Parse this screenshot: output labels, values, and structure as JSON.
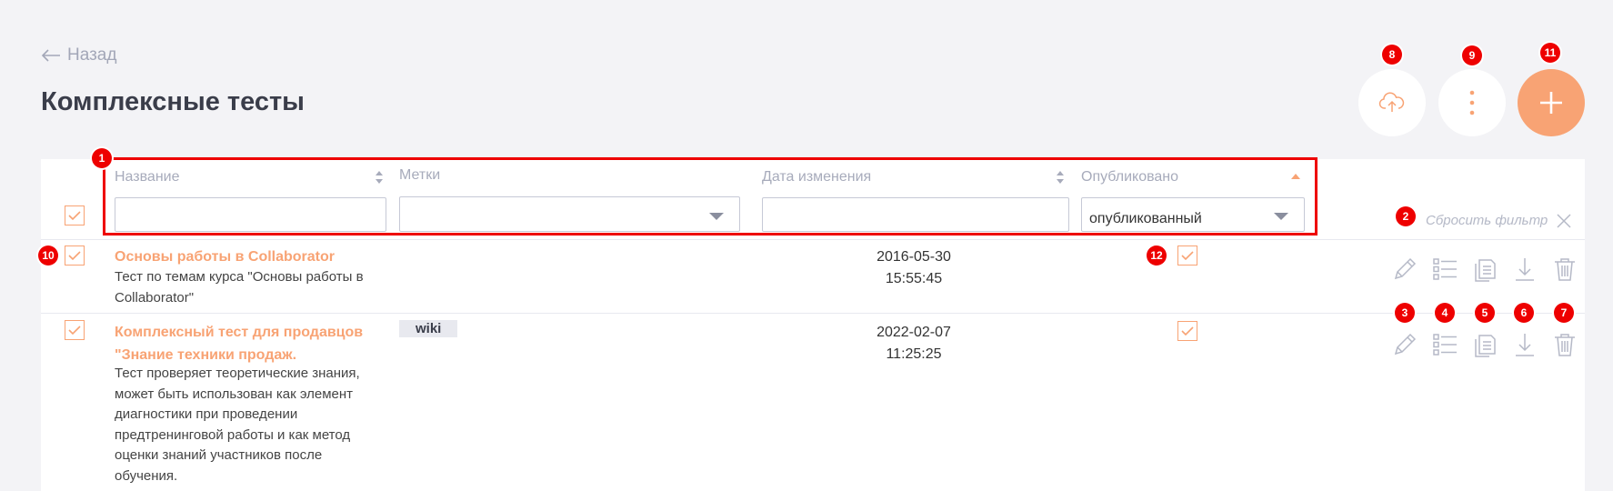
{
  "header": {
    "back_label": "Назад",
    "title": "Комплексные тесты"
  },
  "toolbar": {
    "upload_icon": "cloud-upload-icon",
    "more_icon": "more-vertical-icon",
    "add_icon": "plus-icon"
  },
  "filters": {
    "columns": {
      "name": "Название",
      "tags": "Метки",
      "date": "Дата изменения",
      "published": "Опубликовано"
    },
    "name_value": "",
    "tags_value": "",
    "date_value": "",
    "published_value": "опубликованный",
    "reset_label": "Сбросить фильтр"
  },
  "rows": [
    {
      "title": "Основы работы в Collaborator",
      "description": "Тест по темам курса \"Основы работы в Collaborator\"",
      "tag": "",
      "date": "2016-05-30",
      "time": "15:55:45",
      "published": true
    },
    {
      "title": "Комплексный тест для продавцов \"Знание техники продаж.",
      "description": "Тест проверяет теоретические знания, может быть использован как элемент диагностики при проведении предтренинговой работы и как метод оценки знаний участников после обучения.",
      "tag": "wiki",
      "date": "2022-02-07",
      "time": "11:25:25",
      "published": true
    }
  ],
  "annotations": {
    "filter_box": "1",
    "reset_filter": "2",
    "edit": "3",
    "questions": "4",
    "copy": "5",
    "download": "6",
    "delete": "7",
    "upload": "8",
    "more": "9",
    "row_checkbox": "10",
    "add": "11",
    "published_checkbox": "12"
  },
  "colors": {
    "accent": "#f8a374",
    "annotation": "#e00000",
    "muted": "#a7abbb",
    "background": "#f3f3f6"
  }
}
